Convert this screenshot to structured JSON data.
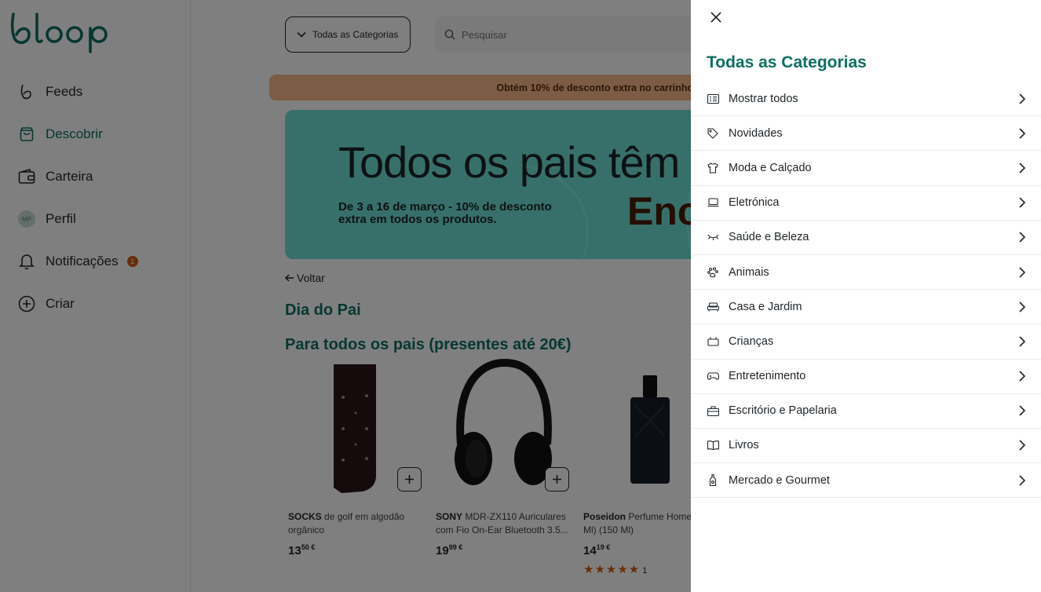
{
  "brand": {
    "logo_text": "bloop",
    "accent": "#0e6f63",
    "badge_color": "#d25c12"
  },
  "sidebar": {
    "items": [
      {
        "label": "Feeds",
        "icon": "feeds-icon"
      },
      {
        "label": "Descobrir",
        "icon": "shopping-bag-icon",
        "active": true
      },
      {
        "label": "Carteira",
        "icon": "wallet-icon"
      },
      {
        "label": "Perfil",
        "icon": "avatar",
        "avatar_initials": "MP"
      },
      {
        "label": "Notificações",
        "icon": "bell-icon",
        "badge": "1"
      },
      {
        "label": "Criar",
        "icon": "plus-circle-icon"
      }
    ]
  },
  "header": {
    "category_select": "Todas as Categorias",
    "search_placeholder": "Pesquisar"
  },
  "promo_bar": {
    "text": "Obtém 10% de desconto extra no carrinho s"
  },
  "hero": {
    "title": "Todos os pais têm u",
    "subtitle": "De 3 a 16 de março - 10% de desconto extra em todos os produtos.",
    "big_word": "Enc"
  },
  "main": {
    "back_label": "Voltar",
    "page_title": "Dia do Pai",
    "section_title": "Para todos os pais (presentes até 20€)"
  },
  "products": [
    {
      "brand": "SOCKS",
      "name": "de golf em algodão orgânico",
      "price_int": "13",
      "price_dec": "50 €"
    },
    {
      "brand": "SONY",
      "name": "MDR-ZX110 Auriculares com Fio On-Ear Bluetooth 3.5...",
      "price_int": "19",
      "price_dec": "99 €"
    },
    {
      "brand": "Poseidon",
      "name": "Perfume Home (150 Ml) (150 Ml)",
      "price_int": "14",
      "price_dec": "19 €",
      "stars": "★★★★★",
      "rating_count": "1"
    }
  ],
  "drawer": {
    "title": "Todas as Categorias",
    "categories": [
      {
        "label": "Mostrar todos",
        "icon": "list-icon"
      },
      {
        "label": "Novidades",
        "icon": "tag-icon"
      },
      {
        "label": "Moda e Calçado",
        "icon": "shirt-icon"
      },
      {
        "label": "Eletrónica",
        "icon": "laptop-icon"
      },
      {
        "label": "Saúde e Beleza",
        "icon": "eyelash-icon"
      },
      {
        "label": "Animais",
        "icon": "paw-icon"
      },
      {
        "label": "Casa e Jardim",
        "icon": "sofa-icon"
      },
      {
        "label": "Crianças",
        "icon": "crib-icon"
      },
      {
        "label": "Entretenimento",
        "icon": "gamepad-icon"
      },
      {
        "label": "Escritório e Papelaria",
        "icon": "briefcase-icon"
      },
      {
        "label": "Livros",
        "icon": "book-icon"
      },
      {
        "label": "Mercado e Gourmet",
        "icon": "bottle-icon"
      }
    ]
  }
}
